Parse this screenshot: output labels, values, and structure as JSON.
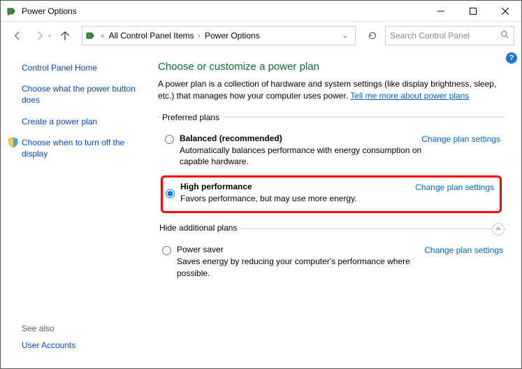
{
  "window": {
    "title": "Power Options"
  },
  "navbar": {
    "breadcrumb": {
      "item1": "All Control Panel Items",
      "item2": "Power Options"
    },
    "search_placeholder": "Search Control Panel"
  },
  "sidebar": {
    "home": "Control Panel Home",
    "choose_button": "Choose what the power button does",
    "create_plan": "Create a power plan",
    "turn_off_display": "Choose when to turn off the display",
    "see_also_label": "See also",
    "user_accounts": "User Accounts"
  },
  "content": {
    "title": "Choose or customize a power plan",
    "intro_prefix": "A power plan is a collection of hardware and system settings (like display brightness, sleep, etc.) that manages how your computer uses power. ",
    "intro_link": "Tell me more about power plans",
    "preferred_legend": "Preferred plans",
    "hide_legend": "Hide additional plans",
    "change_link": "Change plan settings",
    "plans": {
      "balanced": {
        "name": "Balanced (recommended)",
        "desc": "Automatically balances performance with energy consumption on capable hardware."
      },
      "high": {
        "name": "High performance",
        "desc": "Favors performance, but may use more energy."
      },
      "saver": {
        "name": "Power saver",
        "desc": "Saves energy by reducing your computer's performance where possible."
      }
    }
  }
}
